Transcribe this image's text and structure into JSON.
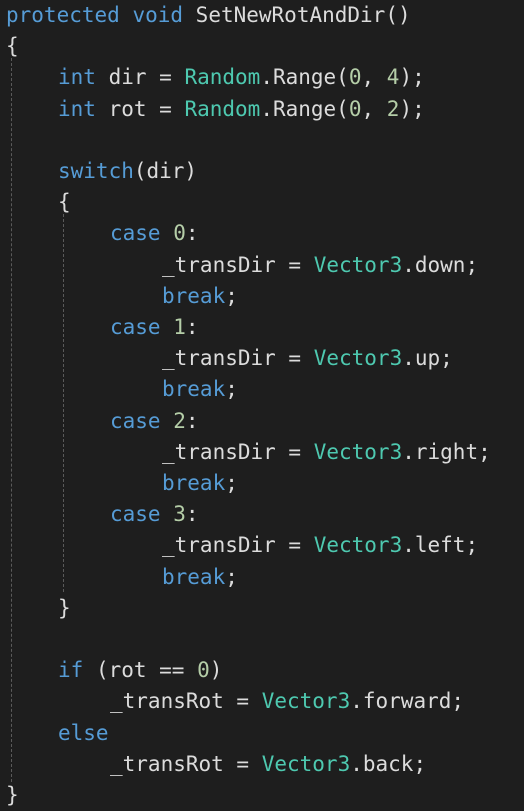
{
  "theme": {
    "background": "#1e1e1e",
    "default": "#dcdcdc",
    "keyword": "#569cd6",
    "type": "#4ec9b0",
    "number": "#b5cea8",
    "guide": "#5a5a5a"
  },
  "code": {
    "lines": [
      {
        "indent": 0,
        "tokens": [
          {
            "t": "protected",
            "k": "keyword"
          },
          {
            "t": " ",
            "k": "plain"
          },
          {
            "t": "void",
            "k": "keyword"
          },
          {
            "t": " SetNewRotAndDir()",
            "k": "plain"
          }
        ]
      },
      {
        "indent": 0,
        "tokens": [
          {
            "t": "{",
            "k": "plain"
          }
        ]
      },
      {
        "indent": 1,
        "tokens": [
          {
            "t": "int",
            "k": "keyword"
          },
          {
            "t": " dir = ",
            "k": "plain"
          },
          {
            "t": "Random",
            "k": "type"
          },
          {
            "t": ".Range(",
            "k": "plain"
          },
          {
            "t": "0",
            "k": "number"
          },
          {
            "t": ", ",
            "k": "plain"
          },
          {
            "t": "4",
            "k": "number"
          },
          {
            "t": ");",
            "k": "plain"
          }
        ]
      },
      {
        "indent": 1,
        "tokens": [
          {
            "t": "int",
            "k": "keyword"
          },
          {
            "t": " rot = ",
            "k": "plain"
          },
          {
            "t": "Random",
            "k": "type"
          },
          {
            "t": ".Range(",
            "k": "plain"
          },
          {
            "t": "0",
            "k": "number"
          },
          {
            "t": ", ",
            "k": "plain"
          },
          {
            "t": "2",
            "k": "number"
          },
          {
            "t": ");",
            "k": "plain"
          }
        ]
      },
      {
        "indent": 0,
        "tokens": []
      },
      {
        "indent": 1,
        "tokens": [
          {
            "t": "switch",
            "k": "keyword"
          },
          {
            "t": "(dir)",
            "k": "plain"
          }
        ]
      },
      {
        "indent": 1,
        "tokens": [
          {
            "t": "{",
            "k": "plain"
          }
        ]
      },
      {
        "indent": 2,
        "tokens": [
          {
            "t": "case",
            "k": "keyword"
          },
          {
            "t": " ",
            "k": "plain"
          },
          {
            "t": "0",
            "k": "number"
          },
          {
            "t": ":",
            "k": "plain"
          }
        ]
      },
      {
        "indent": 3,
        "tokens": [
          {
            "t": "_transDir = ",
            "k": "plain"
          },
          {
            "t": "Vector3",
            "k": "type"
          },
          {
            "t": ".down;",
            "k": "plain"
          }
        ]
      },
      {
        "indent": 3,
        "tokens": [
          {
            "t": "break",
            "k": "keyword"
          },
          {
            "t": ";",
            "k": "plain"
          }
        ]
      },
      {
        "indent": 2,
        "tokens": [
          {
            "t": "case",
            "k": "keyword"
          },
          {
            "t": " ",
            "k": "plain"
          },
          {
            "t": "1",
            "k": "number"
          },
          {
            "t": ":",
            "k": "plain"
          }
        ]
      },
      {
        "indent": 3,
        "tokens": [
          {
            "t": "_transDir = ",
            "k": "plain"
          },
          {
            "t": "Vector3",
            "k": "type"
          },
          {
            "t": ".up;",
            "k": "plain"
          }
        ]
      },
      {
        "indent": 3,
        "tokens": [
          {
            "t": "break",
            "k": "keyword"
          },
          {
            "t": ";",
            "k": "plain"
          }
        ]
      },
      {
        "indent": 2,
        "tokens": [
          {
            "t": "case",
            "k": "keyword"
          },
          {
            "t": " ",
            "k": "plain"
          },
          {
            "t": "2",
            "k": "number"
          },
          {
            "t": ":",
            "k": "plain"
          }
        ]
      },
      {
        "indent": 3,
        "tokens": [
          {
            "t": "_transDir = ",
            "k": "plain"
          },
          {
            "t": "Vector3",
            "k": "type"
          },
          {
            "t": ".right;",
            "k": "plain"
          }
        ]
      },
      {
        "indent": 3,
        "tokens": [
          {
            "t": "break",
            "k": "keyword"
          },
          {
            "t": ";",
            "k": "plain"
          }
        ]
      },
      {
        "indent": 2,
        "tokens": [
          {
            "t": "case",
            "k": "keyword"
          },
          {
            "t": " ",
            "k": "plain"
          },
          {
            "t": "3",
            "k": "number"
          },
          {
            "t": ":",
            "k": "plain"
          }
        ]
      },
      {
        "indent": 3,
        "tokens": [
          {
            "t": "_transDir = ",
            "k": "plain"
          },
          {
            "t": "Vector3",
            "k": "type"
          },
          {
            "t": ".left;",
            "k": "plain"
          }
        ]
      },
      {
        "indent": 3,
        "tokens": [
          {
            "t": "break",
            "k": "keyword"
          },
          {
            "t": ";",
            "k": "plain"
          }
        ]
      },
      {
        "indent": 1,
        "tokens": [
          {
            "t": "}",
            "k": "plain"
          }
        ]
      },
      {
        "indent": 0,
        "tokens": []
      },
      {
        "indent": 1,
        "tokens": [
          {
            "t": "if",
            "k": "keyword"
          },
          {
            "t": " (rot == ",
            "k": "plain"
          },
          {
            "t": "0",
            "k": "number"
          },
          {
            "t": ")",
            "k": "plain"
          }
        ]
      },
      {
        "indent": 2,
        "tokens": [
          {
            "t": "_transRot = ",
            "k": "plain"
          },
          {
            "t": "Vector3",
            "k": "type"
          },
          {
            "t": ".forward;",
            "k": "plain"
          }
        ]
      },
      {
        "indent": 1,
        "tokens": [
          {
            "t": "else",
            "k": "keyword"
          }
        ]
      },
      {
        "indent": 2,
        "tokens": [
          {
            "t": "_transRot = ",
            "k": "plain"
          },
          {
            "t": "Vector3",
            "k": "type"
          },
          {
            "t": ".back;",
            "k": "plain"
          }
        ]
      },
      {
        "indent": 0,
        "tokens": [
          {
            "t": "}",
            "k": "plain"
          }
        ]
      }
    ]
  }
}
